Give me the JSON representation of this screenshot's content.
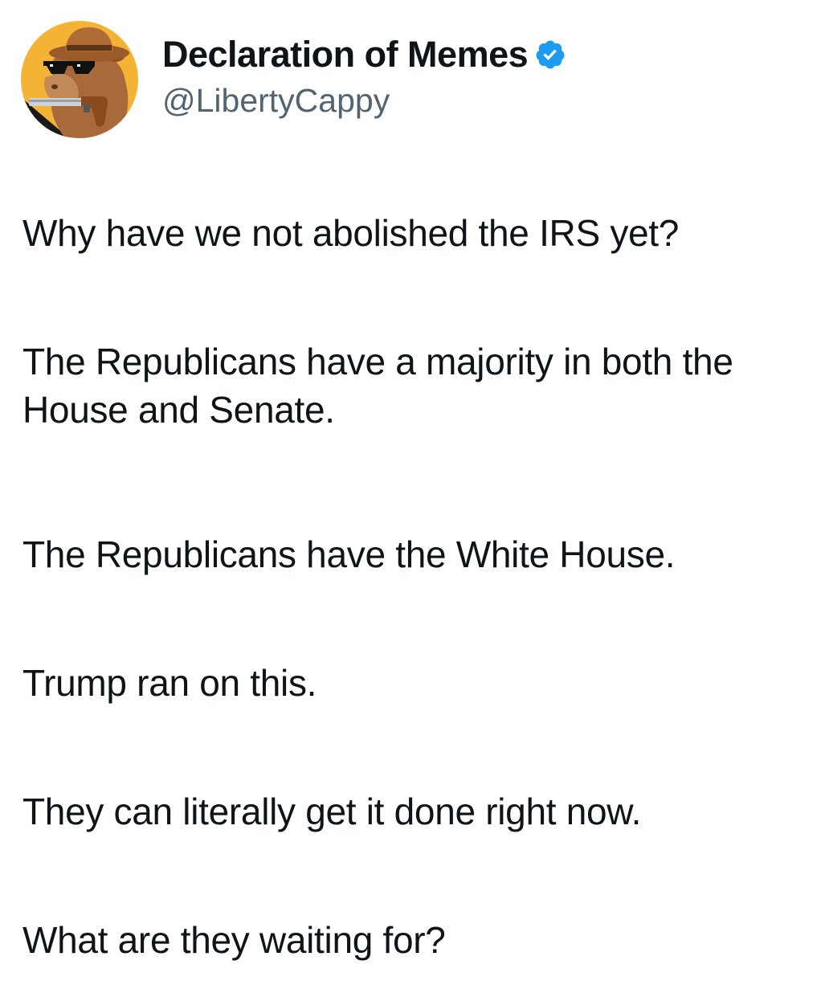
{
  "author": {
    "display_name": "Declaration of Memes",
    "handle": "@LibertyCappy",
    "verified": true,
    "verified_color": "#1d9bf0",
    "avatar_icon": "capybara-cowboy-avatar-icon"
  },
  "tweet": {
    "paragraphs": [
      "Why have we not abolished the IRS yet?",
      "The Republicans have a majority in both the House and Senate.",
      "The Republicans have the White House.",
      "Trump ran on this.",
      "They can literally get it done right now.",
      "What are they waiting for?"
    ]
  }
}
